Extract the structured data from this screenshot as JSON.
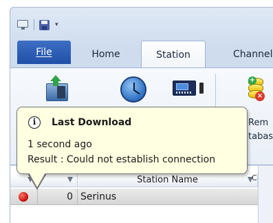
{
  "qat": {
    "dropdown_glyph": "▾"
  },
  "tabs": [
    {
      "label": "File",
      "active": false
    },
    {
      "label": "Home",
      "active": false
    },
    {
      "label": "Station",
      "active": true
    },
    {
      "label": "Channels",
      "active": false
    }
  ],
  "ribbon": {
    "remote_label_line1": "Rem",
    "remote_label_line2": "tabas"
  },
  "tooltip": {
    "title": "Last Download",
    "line1": "1 second ago",
    "line2": "Result : Could not establish connection",
    "info_glyph": "i"
  },
  "grid": {
    "columns": [
      "",
      "",
      "Station Name"
    ],
    "rows": [
      {
        "status_color": "#c8100a",
        "number": "0",
        "name": "Serinus"
      }
    ],
    "side_tab_label": "C"
  }
}
